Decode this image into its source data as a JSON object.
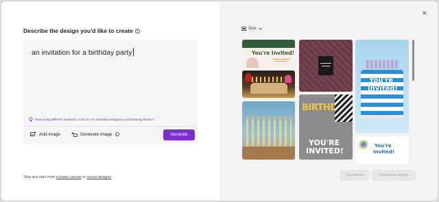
{
  "left": {
    "title": "Describe the design you'd like to create",
    "prompt_value": "an invitation for a birthday party",
    "tip": "Keep trying different variations, such as \"An animated Instagram post featuring flowers.\"",
    "add_image_label": "Add image",
    "generate_image_label": "Generate image",
    "generate_button": "Generate",
    "footer_prefix": "Skip and start from",
    "footer_blank": "a blank canvas",
    "footer_or": "or",
    "footer_recent": "recent designs"
  },
  "right": {
    "size_label": "Size",
    "thumbs": {
      "t1_title": "You're Invited!",
      "t4_line1": "YOU'RE",
      "t4_line2": "INVITED!",
      "t4_bg": "BIRTHDAY",
      "t6_line1": "You're",
      "t6_line2": "Invited!",
      "t7_line1": "You're",
      "t7_line2": "Invited!"
    },
    "download_button": "Download",
    "customize_button": "Customize design"
  },
  "colors": {
    "accent": "#7b2fd1",
    "right_panel_bg": "#f3f3f3"
  },
  "icons": [
    "info-icon",
    "lightbulb-icon",
    "add-image-icon",
    "generate-image-icon",
    "size-icon",
    "chevron-down-icon",
    "close-icon"
  ]
}
